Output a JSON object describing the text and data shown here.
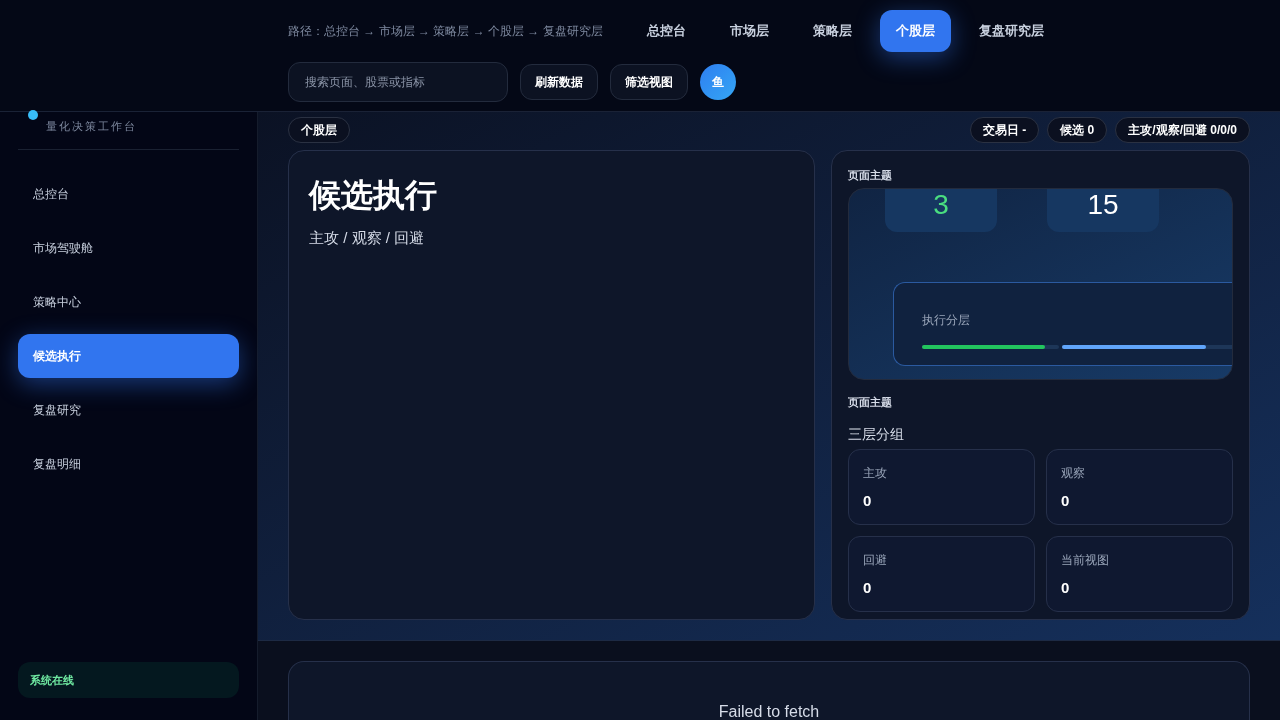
{
  "header": {
    "breadcrumb": "路径：总控台 → 市场层 → 策略层 → 个股层 → 复盘研究层",
    "tabs": [
      {
        "label": "总控台",
        "selected": false
      },
      {
        "label": "市场层",
        "selected": false
      },
      {
        "label": "策略层",
        "selected": false
      },
      {
        "label": "个股层",
        "selected": true
      },
      {
        "label": "复盘研究层",
        "selected": false
      }
    ],
    "search": {
      "placeholder": "搜索页面、股票或指标"
    },
    "buttons": [
      "刷新数据",
      "筛选视图"
    ],
    "avatar": "鱼"
  },
  "sidebar": {
    "subtitle": "量化决策工作台",
    "items": [
      {
        "label": "总控台",
        "selected": false
      },
      {
        "label": "市场驾驶舱",
        "selected": false
      },
      {
        "label": "策略中心",
        "selected": false
      },
      {
        "label": "候选执行",
        "selected": true
      },
      {
        "label": "复盘研究",
        "selected": false
      },
      {
        "label": "复盘明细",
        "selected": false
      }
    ],
    "status": "系统在线"
  },
  "strip": {
    "layer": "个股层",
    "chips": [
      "交易日 -",
      "候选 0",
      "主攻/观察/回避 0/0/0"
    ]
  },
  "main": {
    "title": "候选执行",
    "subtitle": "主攻 / 观察 / 回避"
  },
  "theme": {
    "label": "页面主题",
    "preview": {
      "stats": [
        {
          "value": "3",
          "color": "#4ade80"
        },
        {
          "value": "15",
          "color": "#ffffff"
        }
      ],
      "layer_label": "执行分层",
      "segments": [
        {
          "color": "#22c55e",
          "level": 0.9
        },
        {
          "color": "#60a5fa",
          "level": 0.8
        }
      ]
    },
    "label2": "页面主题",
    "group_title": "三层分组",
    "stats": [
      {
        "label": "主攻",
        "value": "0"
      },
      {
        "label": "观察",
        "value": "0"
      },
      {
        "label": "回避",
        "value": "0"
      },
      {
        "label": "当前视图",
        "value": "0"
      }
    ]
  },
  "error": "Failed to fetch"
}
